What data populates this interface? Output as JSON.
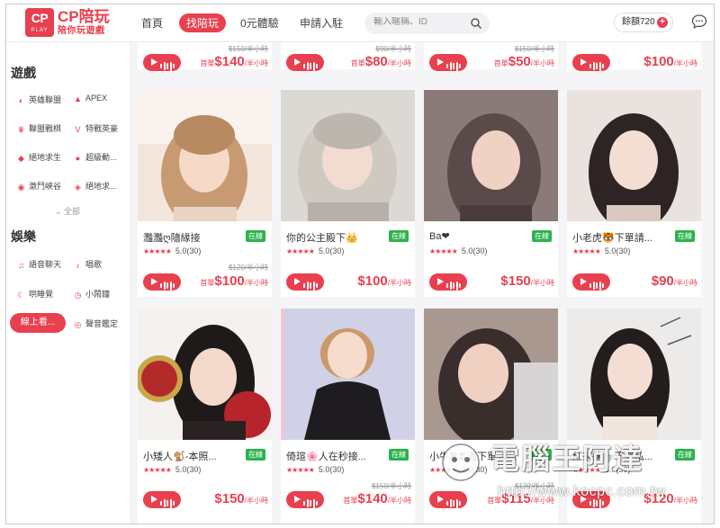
{
  "header": {
    "logo_text": "CP",
    "logo_sub": "PLAY",
    "brand_title": "CP陪玩",
    "brand_slogan": "陪你玩遊戲",
    "nav": [
      "首頁",
      "找陪玩",
      "0元體驗",
      "申請入駐"
    ],
    "search_placeholder": "輸入暱稱、ID",
    "balance_label": "餘額720",
    "accent_color": "#e8404f"
  },
  "sidebar": {
    "games_title": "遊戲",
    "games": [
      {
        "label": "英雄聯盟",
        "icon": "lol-icon"
      },
      {
        "label": "APEX",
        "icon": "apex-icon"
      },
      {
        "label": "聯盟戰棋",
        "icon": "chess-icon"
      },
      {
        "label": "特戰英豪",
        "icon": "valorant-icon"
      },
      {
        "label": "絕地求生",
        "icon": "pubg-icon"
      },
      {
        "label": "超級動...",
        "icon": "smash-icon"
      },
      {
        "label": "激鬥峽谷",
        "icon": "wildrift-icon"
      },
      {
        "label": "絕地求...",
        "icon": "pubgm-icon"
      }
    ],
    "all_label": "全部",
    "ent_title": "娛樂",
    "entertainment": [
      {
        "label": "語音聊天",
        "icon": "headset-icon"
      },
      {
        "label": "唱歌",
        "icon": "mic-icon"
      },
      {
        "label": "哄睡覺",
        "icon": "moon-icon"
      },
      {
        "label": "小鬧鐘",
        "icon": "alarm-icon"
      },
      {
        "label": "線上看...",
        "icon": "tv-icon"
      },
      {
        "label": "聲音鑑定",
        "icon": "voice-icon"
      }
    ]
  },
  "top_row": [
    {
      "old": "$150/半小時",
      "first": "首單",
      "price": "$140",
      "unit": "/半小時"
    },
    {
      "old": "$90/半小時",
      "first": "首單",
      "price": "$80",
      "unit": "/半小時"
    },
    {
      "old": "$150/半小時",
      "first": "首單",
      "price": "$50",
      "unit": "/半小時"
    },
    {
      "old": "",
      "first": "",
      "price": "$100",
      "unit": "/半小時"
    }
  ],
  "cards": [
    {
      "name": "灩灩ღ隨緣接",
      "status": "在線",
      "stars": "★★★★★",
      "rating": "5.0(30)",
      "old": "$120/半小時",
      "first": "首單",
      "price": "$100",
      "unit": "/半小時"
    },
    {
      "name": "你的公主殿下👑",
      "status": "在線",
      "stars": "★★★★★",
      "rating": "5.0(30)",
      "old": "",
      "first": "",
      "price": "$100",
      "unit": "/半小時"
    },
    {
      "name": "Ba❤",
      "status": "在線",
      "stars": "★★★★★",
      "rating": "5.0(30)",
      "old": "",
      "first": "",
      "price": "$150",
      "unit": "/半小時"
    },
    {
      "name": "小老虎🐯下單請...",
      "status": "在線",
      "stars": "★★★★★",
      "rating": "5.0(30)",
      "old": "",
      "first": "",
      "price": "$90",
      "unit": "/半小時"
    },
    {
      "name": "小矮人🐒-本照...",
      "status": "在線",
      "stars": "★★★★★",
      "rating": "5.0(30)",
      "old": "",
      "first": "",
      "price": "$150",
      "unit": "/半小時"
    },
    {
      "name": "倚瑄🌸人在秒接...",
      "status": "在線",
      "stars": "★★★★★",
      "rating": "5.0(30)",
      "old": "$150/半小時",
      "first": "首單",
      "price": "$140",
      "unit": "/半小時"
    },
    {
      "name": "小牛ꕤ本週下單先私",
      "status": "在線",
      "stars": "★★★★★",
      "rating": "5.0(30)",
      "old": "$130/半小時",
      "first": "首單",
      "price": "$115",
      "unit": "/半小時"
    },
    {
      "name": "紅茶妹🍵下單私...",
      "status": "在線",
      "stars": "★★★★★",
      "rating": "5.0(30)",
      "old": "",
      "first": "",
      "price": "$120",
      "unit": "/半小時"
    }
  ],
  "watermark": {
    "title": "電腦王阿達",
    "url": "http://www.kocpc.com.tw"
  }
}
